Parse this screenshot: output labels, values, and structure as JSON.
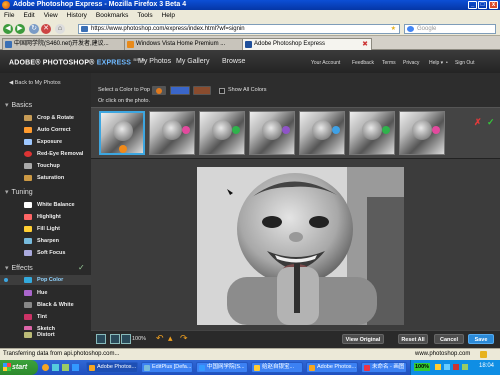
{
  "window": {
    "title": "Adobe Photoshop Express - Mozilla Firefox 3 Beta 4",
    "controls": [
      "_",
      "□",
      "x"
    ]
  },
  "menu": [
    "File",
    "Edit",
    "View",
    "History",
    "Bookmarks",
    "Tools",
    "Help"
  ],
  "nav": {
    "url": "https://www.photoshop.com/express/index.html?wf=signin",
    "search_placeholder": "Google"
  },
  "tabs": [
    {
      "label": "中国网学院(S460.net)开发者,建议..."
    },
    {
      "label": "Windows Vista Home Premium ..."
    },
    {
      "label": "Adobe Photoshop Express"
    }
  ],
  "app": {
    "logo_main": "ADOBE® PHOTOSHOP®",
    "logo_express": "EXPRESS",
    "logo_beta": "BETA",
    "nav": [
      "My Photos",
      "My Gallery",
      "Browse"
    ],
    "links": [
      "Your Account",
      "Feedback",
      "Terms",
      "Privacy",
      "Help ▾",
      "•",
      "Sign Out"
    ]
  },
  "sidebar": {
    "back": "◀ Back to My Photos",
    "sections": [
      {
        "title": "Basics",
        "items": [
          "Crop & Rotate",
          "Auto Correct",
          "Exposure",
          "Red-Eye Removal",
          "Touchup",
          "Saturation"
        ]
      },
      {
        "title": "Tuning",
        "items": [
          "White Balance",
          "Highlight",
          "Fill Light",
          "Sharpen",
          "Soft Focus"
        ]
      },
      {
        "title": "Effects",
        "items": [
          "Pop Color",
          "Hue",
          "Black & White",
          "Tint",
          "Sketch",
          "Distort"
        ]
      }
    ],
    "selected": "Pop Color",
    "item_colors": [
      "#c79c56",
      "#ff9b2e",
      "#9ec8ff",
      "#d33",
      "#aaa",
      "#c94",
      "#fff",
      "#f66",
      "#ffcf33",
      "#7bd",
      "#aad",
      "#3ad",
      "#a6c",
      "#888",
      "#c36",
      "#d6a",
      "#bb7"
    ]
  },
  "toolbar": {
    "select_label": "Select a Color to Pop",
    "click_label": "Or click on the photo.",
    "show_all": "Show All Colors",
    "swatches": [
      "#e07a1e",
      "#3a66c9",
      "#8a4c2e"
    ]
  },
  "filmstrip": {
    "selected_index": 0,
    "accent_colors": [
      "#f08a1a",
      "#e34a9e",
      "#2fb34c",
      "#8f54c8",
      "#3fa1e6",
      "#2fb34c",
      "#e34a9e"
    ]
  },
  "photo_alt": "laughing baby black and white",
  "bottom": {
    "zoom": "100%",
    "view_original": "View Original",
    "reset_all": "Reset All",
    "cancel": "Cancel",
    "save": "Save"
  },
  "status": {
    "text": "Transferring data from api.photoshop.com...",
    "right": "www.photoshop.com"
  },
  "taskbar": {
    "start": "start",
    "tasks": [
      "Adobe Photos...",
      "EditPlus [Defa...",
      "中国网学院(S...",
      "给赵自银宝...",
      "Adobe Photos...",
      "未命名 - 画图"
    ],
    "battery": "100%",
    "time": "18:04"
  },
  "colors": {
    "accent": "#3da6e0",
    "save": "#2b8ad8",
    "check": "#35c53a",
    "cross": "#e03a3a"
  }
}
